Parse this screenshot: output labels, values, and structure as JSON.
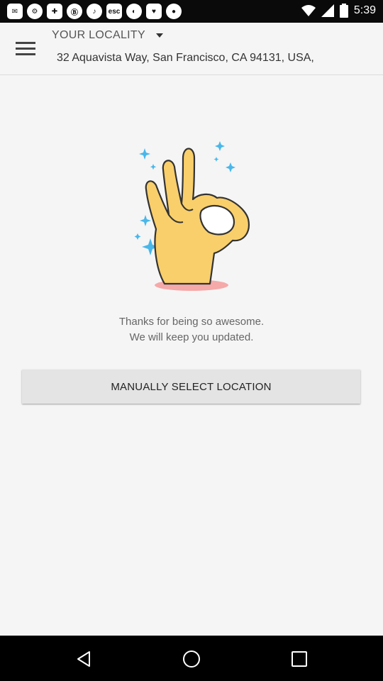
{
  "status_bar": {
    "time": "5:39",
    "icons": [
      "notification-icon-1",
      "notification-icon-2",
      "notification-icon-3",
      "notification-icon-4",
      "notification-icon-5",
      "esc-icon",
      "notification-icon-7",
      "notification-icon-8",
      "notification-icon-9",
      "wifi-icon",
      "signal-icon",
      "battery-icon"
    ],
    "esc_label": "esc"
  },
  "header": {
    "locality_label": "YOUR LOCALITY",
    "address": "32 Aquavista Way, San Francisco, CA 94131, USA,"
  },
  "main": {
    "message_line1": "Thanks for being so awesome.",
    "message_line2": "We will keep you updated.",
    "manual_button_label": "MANUALLY SELECT LOCATION"
  },
  "colors": {
    "hand_fill": "#f9cf6b",
    "hand_stroke": "#333333",
    "sparkle": "#49b7ea",
    "shadow": "#f5a9a9"
  }
}
